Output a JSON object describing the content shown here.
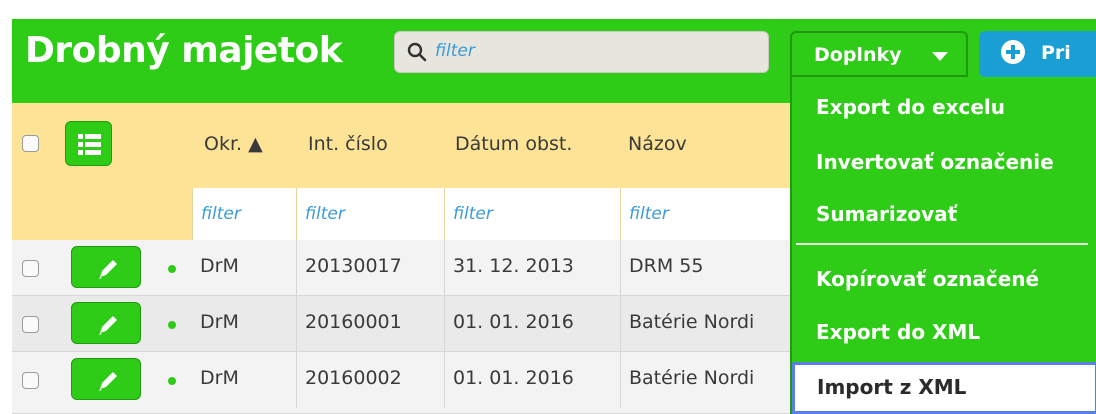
{
  "header": {
    "title": "Drobný majetok",
    "search_placeholder": "filter",
    "doplnky_label": "Doplnky",
    "pridat_label": "Pri"
  },
  "table": {
    "columns": [
      {
        "label": "Okr. ▲"
      },
      {
        "label": "Int. číslo"
      },
      {
        "label": "Dátum obst."
      },
      {
        "label": "Názov"
      }
    ],
    "filter_placeholder": "filter",
    "rows": [
      {
        "okr": "DrM",
        "int_cislo": "20130017",
        "datum": "31. 12. 2013",
        "nazov": "DRM 55"
      },
      {
        "okr": "DrM",
        "int_cislo": "20160001",
        "datum": "01. 01. 2016",
        "nazov": "Batérie Nordi"
      },
      {
        "okr": "DrM",
        "int_cislo": "20160002",
        "datum": "01. 01. 2016",
        "nazov": "Batérie Nordi"
      }
    ]
  },
  "menu": {
    "items": [
      "Export do excelu",
      "Invertovať označenie",
      "Sumarizovať",
      "Kopírovať označené",
      "Export do XML",
      "Import z XML"
    ]
  },
  "colors": {
    "brand_green": "#2ecc16",
    "header_yellow": "#fce396",
    "accent_blue": "#1a9fd4"
  }
}
